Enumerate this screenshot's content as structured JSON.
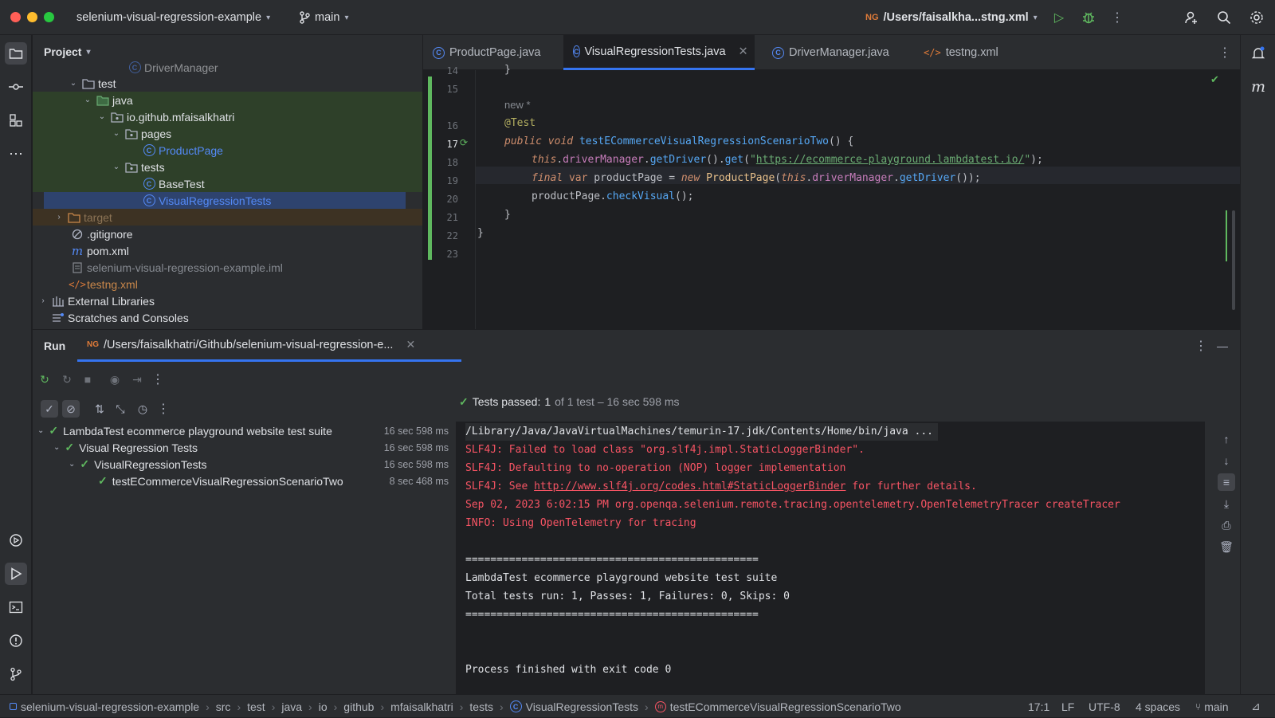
{
  "titlebar": {
    "project_name": "selenium-visual-regression-example",
    "branch": "main",
    "run_config": "/Users/faisalkha...stng.xml"
  },
  "project_panel": {
    "title": "Project",
    "items": [
      {
        "label": "DriverManager"
      },
      {
        "label": "test"
      },
      {
        "label": "java"
      },
      {
        "label": "io.github.mfaisalkhatri"
      },
      {
        "label": "pages"
      },
      {
        "label": "ProductPage"
      },
      {
        "label": "tests"
      },
      {
        "label": "BaseTest"
      },
      {
        "label": "VisualRegressionTests"
      },
      {
        "label": "target"
      },
      {
        "label": ".gitignore"
      },
      {
        "label": "pom.xml"
      },
      {
        "label": "selenium-visual-regression-example.iml"
      },
      {
        "label": "testng.xml"
      },
      {
        "label": "External Libraries"
      },
      {
        "label": "Scratches and Consoles"
      }
    ]
  },
  "editor": {
    "tabs": [
      {
        "label": "ProductPage.java"
      },
      {
        "label": "VisualRegressionTests.java"
      },
      {
        "label": "DriverManager.java"
      },
      {
        "label": "testng.xml"
      }
    ],
    "line_numbers": [
      "14",
      "15",
      "16",
      "17",
      "18",
      "19",
      "20",
      "21",
      "22",
      "23"
    ],
    "hint": "new *",
    "code": {
      "l14": "}",
      "annotation": "@Test",
      "kw_public": "public",
      "kw_void": "void",
      "method_name": "testECommerceVisualRegressionScenarioTwo",
      "l17_tail": "() {",
      "kw_this": "this",
      "driver_manager": "driverManager",
      "get_driver": "getDriver",
      "get": "get",
      "url": "https://ecommerce-playground.lambdatest.io/",
      "kw_final": "final",
      "kw_var": "var",
      "product_page_var": "productPage",
      "kw_new": "new",
      "product_page_cls": "ProductPage",
      "check_visual": "checkVisual",
      "close_inner": "}",
      "close_outer": "}"
    }
  },
  "run_panel": {
    "title": "Run",
    "tab_label": "/Users/faisalkhatri/Github/selenium-visual-regression-e...",
    "status_passed": "Tests passed:",
    "status_count": "1",
    "status_rest": "of 1 test – 16 sec 598 ms",
    "tree": [
      {
        "label": "LambdaTest ecommerce playground website test suite",
        "time": "16 sec 598 ms"
      },
      {
        "label": "Visual Regression Tests",
        "time": "16 sec 598 ms"
      },
      {
        "label": "VisualRegressionTests",
        "time": "16 sec 598 ms"
      },
      {
        "label": "testECommerceVisualRegressionScenarioTwo",
        "time": "8 sec 468 ms"
      }
    ],
    "console": {
      "l1": "/Library/Java/JavaVirtualMachines/temurin-17.jdk/Contents/Home/bin/java ...",
      "l2": "SLF4J: Failed to load class \"org.slf4j.impl.StaticLoggerBinder\".",
      "l3": "SLF4J: Defaulting to no-operation (NOP) logger implementation",
      "l4_pre": "SLF4J: See ",
      "l4_link": "http://www.slf4j.org/codes.html#StaticLoggerBinder",
      "l4_post": " for further details.",
      "l5": "Sep 02, 2023 6:02:15 PM org.openqa.selenium.remote.tracing.opentelemetry.OpenTelemetryTracer createTracer",
      "l6": "INFO: Using OpenTelemetry for tracing",
      "l8": "===============================================",
      "l9": "LambdaTest ecommerce playground website test suite",
      "l10": "Total tests run: 1, Passes: 1, Failures: 0, Skips: 0",
      "l11": "===============================================",
      "l14": "Process finished with exit code 0"
    }
  },
  "statusbar": {
    "crumbs": [
      "selenium-visual-regression-example",
      "src",
      "test",
      "java",
      "io",
      "github",
      "mfaisalkhatri",
      "tests",
      "VisualRegressionTests",
      "testECommerceVisualRegressionScenarioTwo"
    ],
    "position": "17:1",
    "line_sep": "LF",
    "encoding": "UTF-8",
    "indent": "4 spaces",
    "branch": "main"
  },
  "colors": {
    "accent": "#3574f0",
    "pass": "#5fb85f",
    "error": "#f75464"
  }
}
